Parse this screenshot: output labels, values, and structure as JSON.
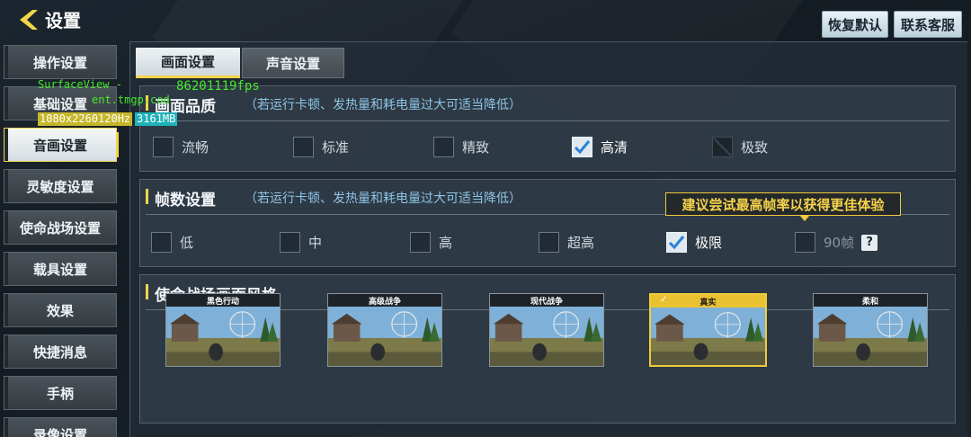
{
  "header": {
    "title": "设置",
    "restore_label": "恢复默认",
    "service_label": "联系客服"
  },
  "sidebar": {
    "items": [
      {
        "label": "操作设置"
      },
      {
        "label": "基础设置"
      },
      {
        "label": "音画设置",
        "active": true
      },
      {
        "label": "灵敏度设置"
      },
      {
        "label": "使命战场设置"
      },
      {
        "label": "载具设置"
      },
      {
        "label": "效果"
      },
      {
        "label": "快捷消息"
      },
      {
        "label": "手柄"
      },
      {
        "label": "录像设置"
      }
    ]
  },
  "tabs": [
    {
      "label": "画面设置",
      "active": true
    },
    {
      "label": "声音设置"
    }
  ],
  "quality": {
    "title": "画面品质",
    "hint": "（若运行卡顿、发热量和耗电量过大可适当降低）",
    "options": [
      {
        "label": "流畅",
        "checked": false
      },
      {
        "label": "标准",
        "checked": false
      },
      {
        "label": "精致",
        "checked": false
      },
      {
        "label": "高清",
        "checked": true
      },
      {
        "label": "极致",
        "checked": false,
        "disabled": true
      }
    ]
  },
  "framerate": {
    "title": "帧数设置",
    "hint": "（若运行卡顿、发热量和耗电量过大可适当降低）",
    "tooltip": "建议尝试最高帧率以获得更佳体验",
    "options": [
      {
        "label": "低",
        "checked": false
      },
      {
        "label": "中",
        "checked": false
      },
      {
        "label": "高",
        "checked": false
      },
      {
        "label": "超高",
        "checked": false
      },
      {
        "label": "极限",
        "checked": true
      },
      {
        "label": "90帧",
        "checked": false
      }
    ],
    "help_label": "?"
  },
  "style": {
    "title": "使命战场画面风格",
    "cards": [
      {
        "label": "黑色行动",
        "selected": false
      },
      {
        "label": "高级战争",
        "selected": false
      },
      {
        "label": "现代战争",
        "selected": false
      },
      {
        "label": "真实",
        "selected": true
      },
      {
        "label": "柔和",
        "selected": false
      }
    ]
  },
  "debug_overlay": {
    "fps": "86201119fps",
    "surface": "SurfaceView -",
    "package": "ent.tmgp.cod",
    "resolution": "1080x2260120Hz",
    "memory": "3161MB"
  },
  "colors": {
    "accent": "#f4d54a",
    "hint": "#8fc4e6"
  }
}
